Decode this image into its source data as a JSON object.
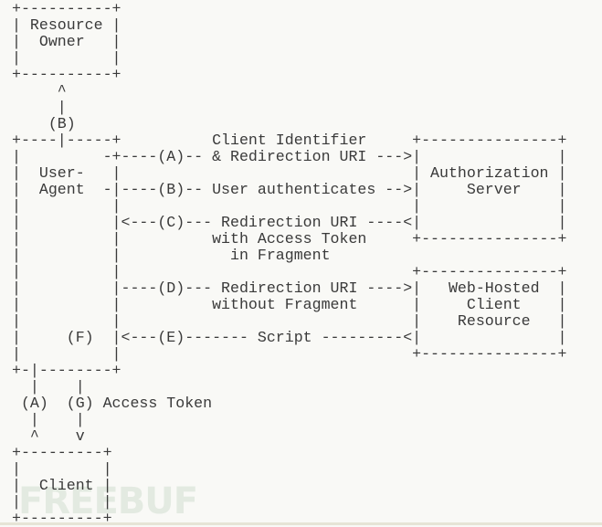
{
  "diagram": {
    "lines": [
      "+----------+",
      "| Resource |",
      "|  Owner   |",
      "|          |",
      "+----------+",
      "     ^",
      "     |",
      "    (B)",
      "+----|-----+          Client Identifier     +---------------+",
      "|         -+----(A)-- & Redirection URI --->|               |",
      "|  User-   |                                | Authorization |",
      "|  Agent  -|----(B)-- User authenticates -->|     Server    |",
      "|          |                                |               |",
      "|          |<---(C)--- Redirection URI ----<|               |",
      "|          |          with Access Token     +---------------+",
      "|          |            in Fragment",
      "|          |                                +---------------+",
      "|          |----(D)--- Redirection URI ---->|   Web-Hosted  |",
      "|          |          without Fragment      |     Client    |",
      "|          |                                |    Resource   |",
      "|     (F)  |<---(E)------- Script ---------<|               |",
      "|          |                                +---------------+",
      "+-|--------+",
      "  |    |",
      " (A)  (G) Access Token",
      "  |    |",
      "  ^    v",
      "+---------+",
      "|         |",
      "|  Client |",
      "|         |",
      "+---------+"
    ]
  },
  "watermark": "FREEBUF"
}
